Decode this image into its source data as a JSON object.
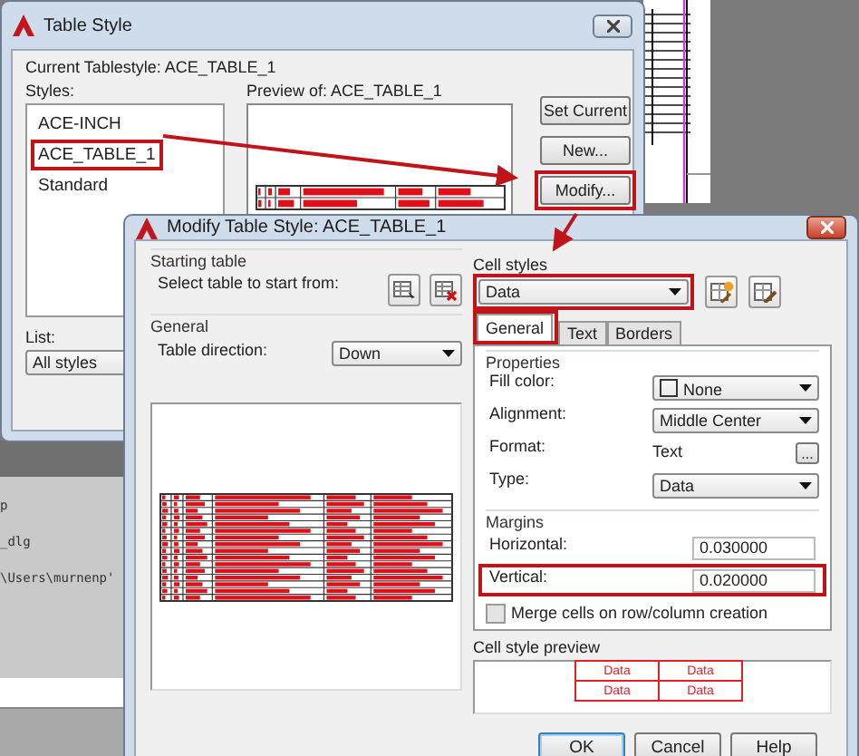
{
  "command_window": {
    "lines": [
      "p",
      "_dlg",
      "\\Users\\murnenp'"
    ]
  },
  "table_style": {
    "title": "Table Style",
    "current": "Current Tablestyle: ACE_TABLE_1",
    "styles_label": "Styles:",
    "preview_label": "Preview of: ACE_TABLE_1",
    "list_label": "List:",
    "list_value": "All styles",
    "styles": [
      {
        "label": "ACE-INCH",
        "highlighted": false
      },
      {
        "label": "ACE_TABLE_1",
        "highlighted": true
      },
      {
        "label": "Standard",
        "highlighted": false
      }
    ],
    "buttons": [
      {
        "label": "Set Current",
        "highlighted": false
      },
      {
        "label": "New...",
        "highlighted": false
      },
      {
        "label": "Modify...",
        "highlighted": true
      }
    ]
  },
  "modify": {
    "title": "Modify Table Style: ACE_TABLE_1",
    "starting_table": {
      "heading": "Starting table",
      "label": "Select table to start from:"
    },
    "general": {
      "heading": "General",
      "label": "Table direction:",
      "value": "Down"
    },
    "cell_styles": {
      "label": "Cell styles",
      "value": "Data",
      "highlighted": true
    },
    "tabs": [
      {
        "label": "General",
        "selected": true,
        "highlighted": true
      },
      {
        "label": "Text",
        "selected": false,
        "highlighted": false
      },
      {
        "label": "Borders",
        "selected": false,
        "highlighted": false
      }
    ],
    "properties": {
      "heading": "Properties",
      "rows": [
        {
          "kind": "color",
          "label": "Fill color:",
          "value": "None"
        },
        {
          "kind": "dropdown",
          "label": "Alignment:",
          "value": "Middle Center"
        },
        {
          "kind": "text",
          "label": "Format:",
          "value": "Text",
          "button": "..."
        },
        {
          "kind": "dropdown",
          "label": "Type:",
          "value": "Data"
        }
      ]
    },
    "margins": {
      "heading": "Margins",
      "rows": [
        {
          "label": "Horizontal:",
          "value": "0.030000",
          "highlighted": false
        },
        {
          "label": "Vertical:",
          "value": "0.020000",
          "highlighted": true
        }
      ]
    },
    "merge": {
      "label": "Merge cells on row/column creation",
      "checked": false
    },
    "cell_preview": {
      "label": "Cell style preview",
      "cells": [
        "Data",
        "Data",
        "Data",
        "Data"
      ]
    },
    "buttons": [
      "OK",
      "Cancel",
      "Help"
    ]
  }
}
